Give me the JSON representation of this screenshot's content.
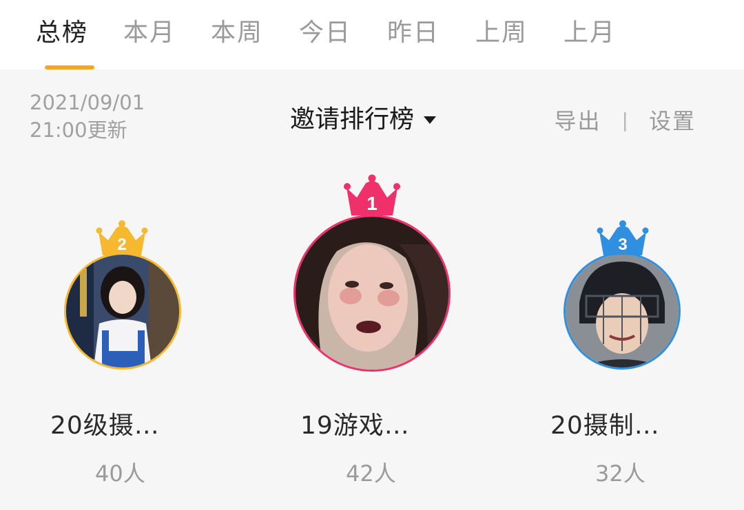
{
  "tabs": [
    {
      "label": "总榜",
      "active": true
    },
    {
      "label": "本月"
    },
    {
      "label": "本周"
    },
    {
      "label": "今日"
    },
    {
      "label": "昨日"
    },
    {
      "label": "上周"
    },
    {
      "label": "上月"
    }
  ],
  "update": {
    "date": "2021/09/01",
    "time": "21:00更新"
  },
  "board": {
    "title": "邀请排行榜",
    "caret_icon": "caret-down-icon"
  },
  "actions": {
    "export_label": "导出",
    "separator": "|",
    "settings_label": "设置"
  },
  "podium": [
    {
      "rank": "2",
      "name": "20级摄…",
      "count": "40人",
      "color": "#f5b82e",
      "crown_icon": "crown-icon"
    },
    {
      "rank": "1",
      "name": "19游戏…",
      "count": "42人",
      "color": "#f0306a",
      "crown_icon": "crown-icon"
    },
    {
      "rank": "3",
      "name": "20摄制…",
      "count": "32人",
      "color": "#2f8fe0",
      "crown_icon": "crown-icon"
    }
  ],
  "colors": {
    "accent": "#f5a623",
    "background": "#f6f6f6"
  }
}
